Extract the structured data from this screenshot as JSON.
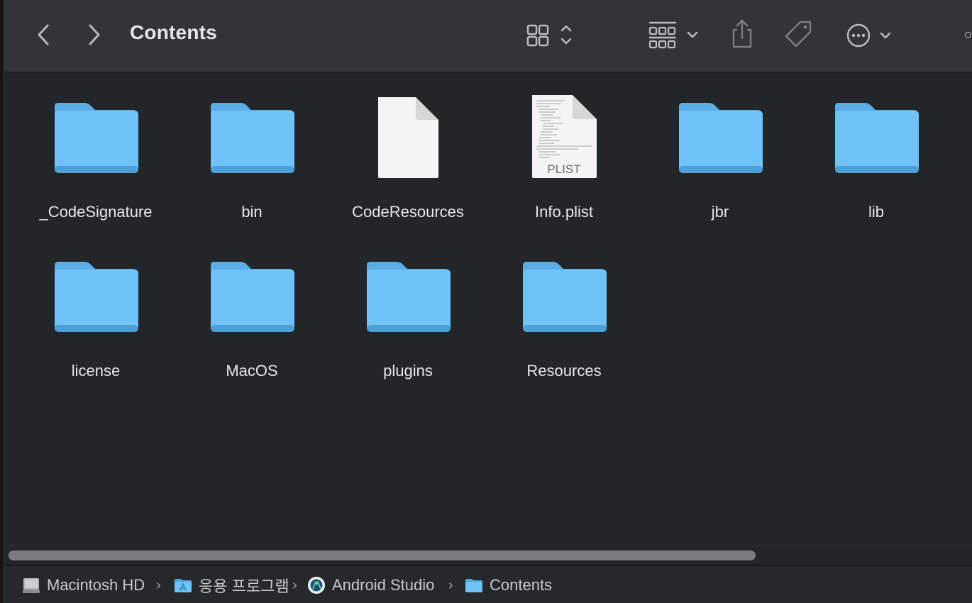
{
  "window": {
    "title": "Contents"
  },
  "toolbar": {
    "back_icon": "chevron-left-icon",
    "forward_icon": "chevron-right-icon",
    "view_icon": "grid-view-icon",
    "group_icon": "group-by-icon",
    "share_icon": "share-icon",
    "tag_icon": "tag-icon",
    "more_icon": "ellipsis-circle-icon"
  },
  "items": [
    {
      "name": "_CodeSignature",
      "kind": "folder"
    },
    {
      "name": "bin",
      "kind": "folder"
    },
    {
      "name": "CodeResources",
      "kind": "document"
    },
    {
      "name": "Info.plist",
      "kind": "plist",
      "badge": "PLIST"
    },
    {
      "name": "jbr",
      "kind": "folder"
    },
    {
      "name": "lib",
      "kind": "folder"
    },
    {
      "name": "license",
      "kind": "folder"
    },
    {
      "name": "MacOS",
      "kind": "folder"
    },
    {
      "name": "plugins",
      "kind": "folder"
    },
    {
      "name": "Resources",
      "kind": "folder"
    }
  ],
  "scrollbar": {
    "horizontal_visible_fraction": 0.78
  },
  "pathbar": {
    "crumbs": [
      {
        "label": "Macintosh HD",
        "icon": "hard-drive-icon"
      },
      {
        "label": "응용 프로그램",
        "icon": "applications-folder-icon"
      },
      {
        "label": "Android Studio",
        "icon": "android-studio-app-icon"
      },
      {
        "label": "Contents",
        "icon": "folder-icon"
      }
    ]
  },
  "colors": {
    "folder_body": "#6fc3f6",
    "folder_tab": "#5aaee6",
    "toolbar_bg": "#323537",
    "content_bg": "#222628"
  }
}
